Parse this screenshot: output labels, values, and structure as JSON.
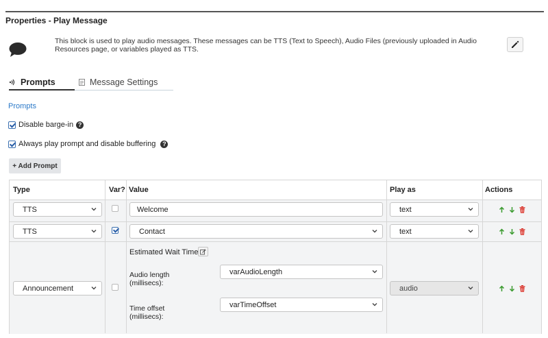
{
  "header": {
    "title": "Properties - Play Message",
    "description": "This block is used to play audio messages. These messages can be TTS (Text to Speech), Audio Files (previously uploaded in Audio Resources page, or variables played as TTS."
  },
  "tabs": [
    {
      "label": "Prompts",
      "active": true,
      "icon": "audio-wave-icon"
    },
    {
      "label": "Message Settings",
      "active": false,
      "icon": "document-icon"
    }
  ],
  "section": {
    "label": "Prompts"
  },
  "options": {
    "disable_barge_in": {
      "label": "Disable barge-in",
      "checked": true
    },
    "always_play": {
      "label": "Always play prompt and disable buffering",
      "checked": true
    }
  },
  "add_prompt": {
    "label": "+ Add Prompt"
  },
  "table": {
    "headers": {
      "type": "Type",
      "var": "Var?",
      "value": "Value",
      "play_as": "Play as",
      "actions": "Actions"
    },
    "rows": [
      {
        "type": "TTS",
        "var": false,
        "value": "Welcome",
        "value_kind": "text",
        "play_as": "text"
      },
      {
        "type": "TTS",
        "var": true,
        "value": "Contact",
        "value_kind": "select",
        "play_as": "text"
      },
      {
        "type": "Announcement",
        "var": false,
        "play_as": "audio",
        "announcement": {
          "name": "Estimated Wait Time",
          "audio_length_label": "Audio length (millisecs):",
          "audio_length_value": "varAudioLength",
          "time_offset_label": "Time offset (millisecs):",
          "time_offset_value": "varTimeOffset"
        }
      }
    ]
  },
  "colors": {
    "accent": "#2a78c8",
    "up": "#3a9a2e",
    "down": "#3a9a2e",
    "delete": "#d9342b"
  }
}
